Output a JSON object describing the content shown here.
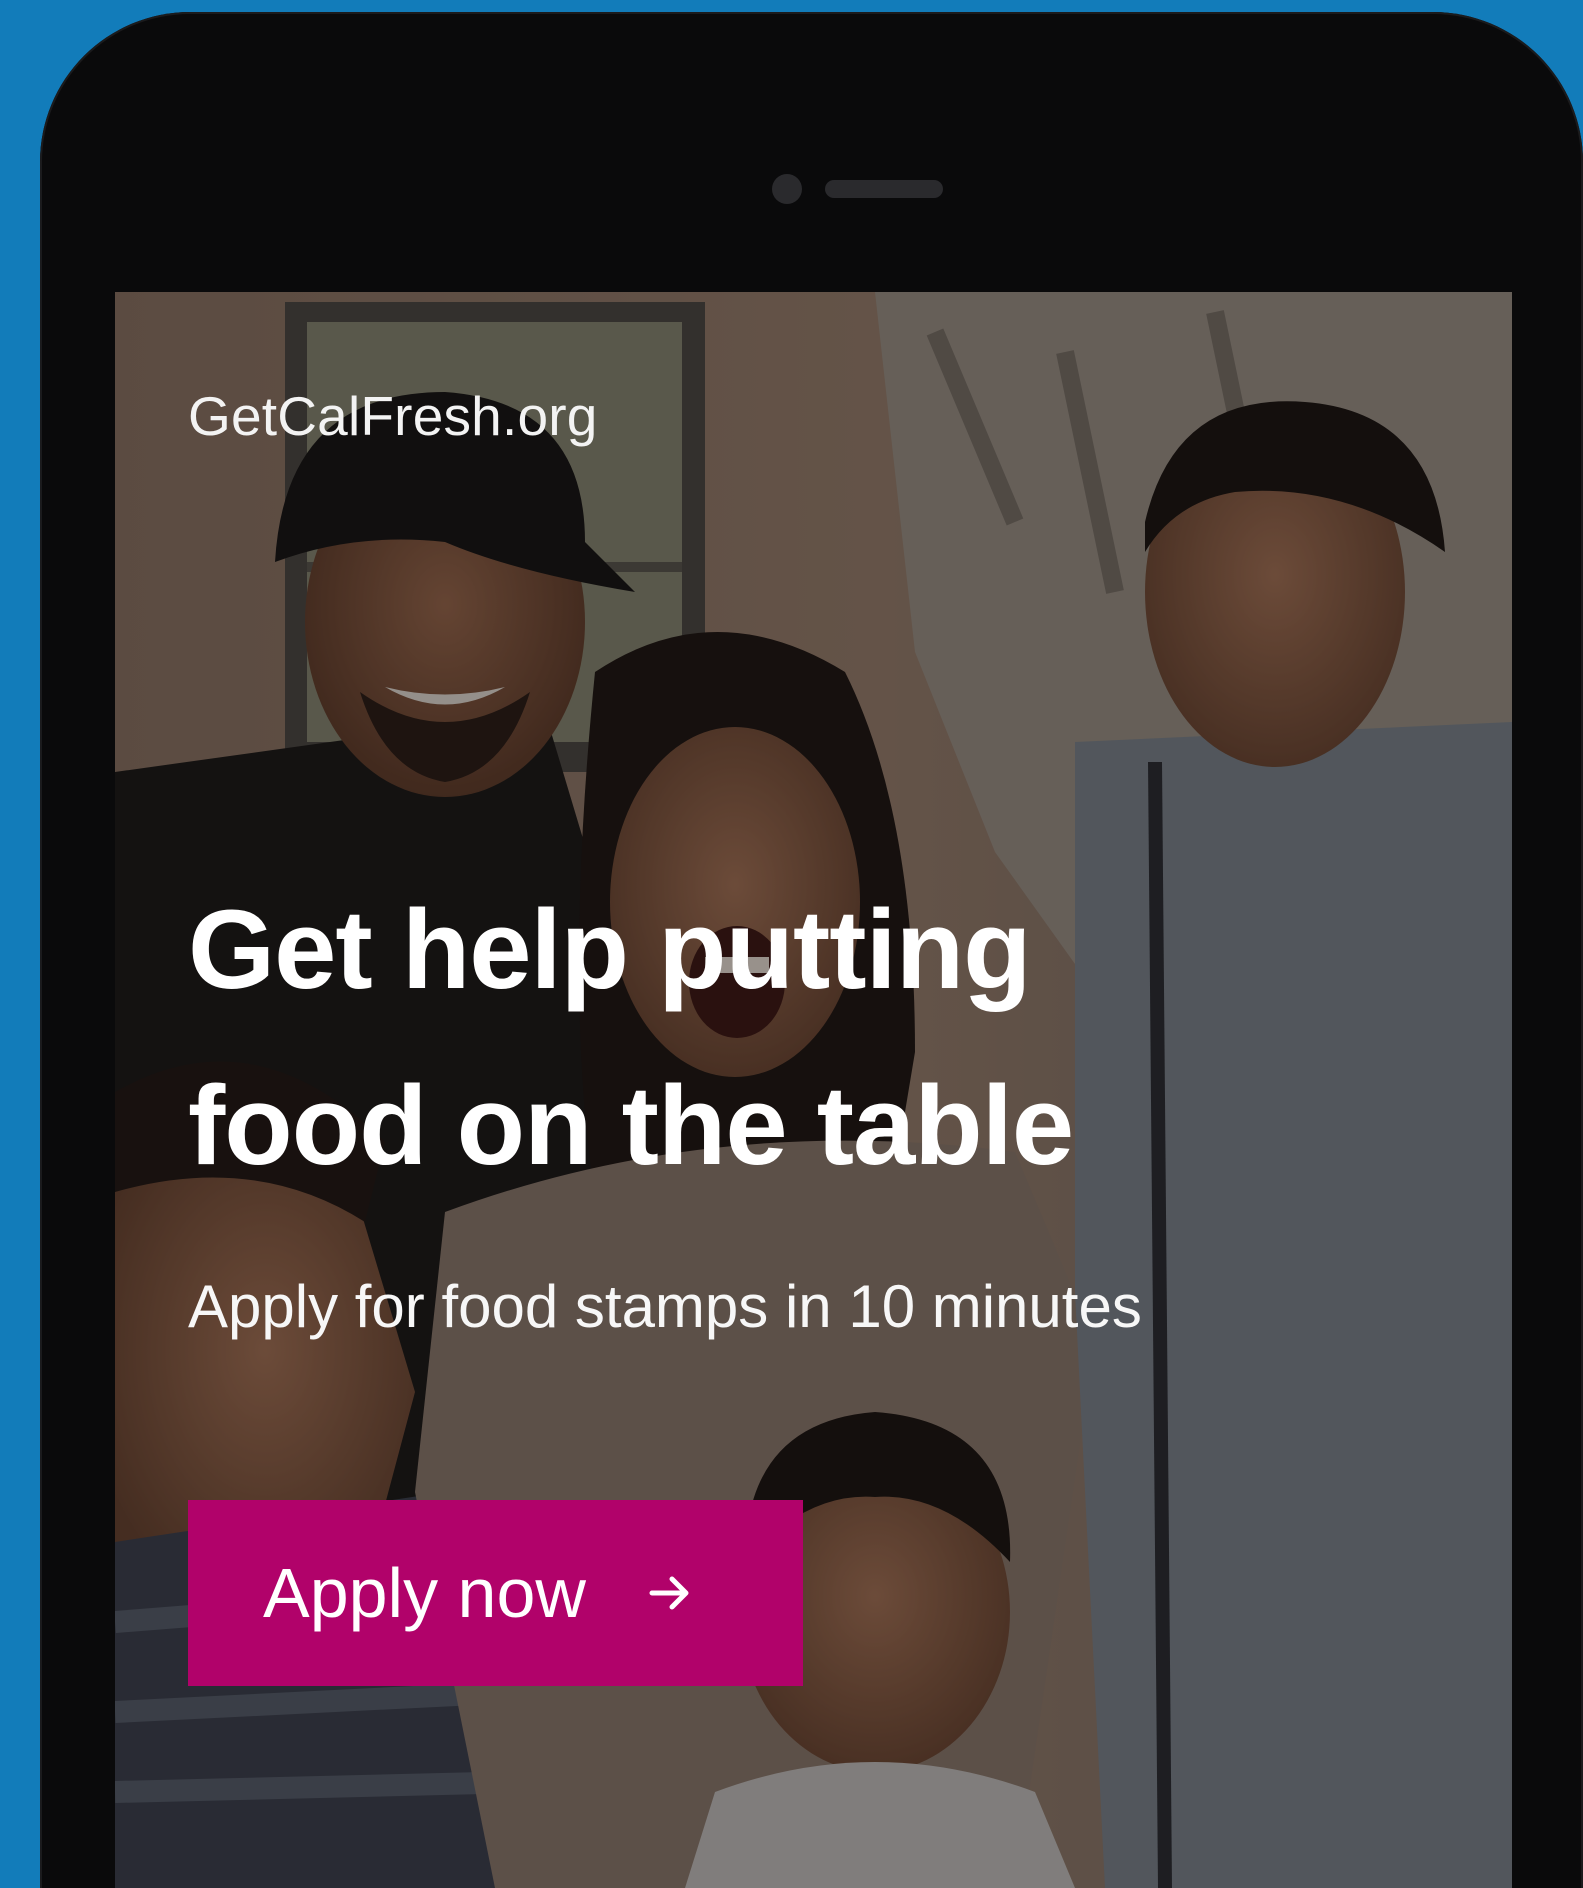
{
  "brand": "GetCalFresh.org",
  "headline": {
    "line1": "Get help putting",
    "line2": "food on the table"
  },
  "subheadline": "Apply for food stamps in 10 minutes",
  "cta": {
    "label": "Apply now",
    "icon": "arrow-right-icon",
    "color": "#b1026a"
  },
  "colors": {
    "background": "#127cba",
    "phone_frame": "#0a0a0b"
  },
  "hero_image": {
    "subject": "family photo",
    "icon": "hero-photo"
  }
}
